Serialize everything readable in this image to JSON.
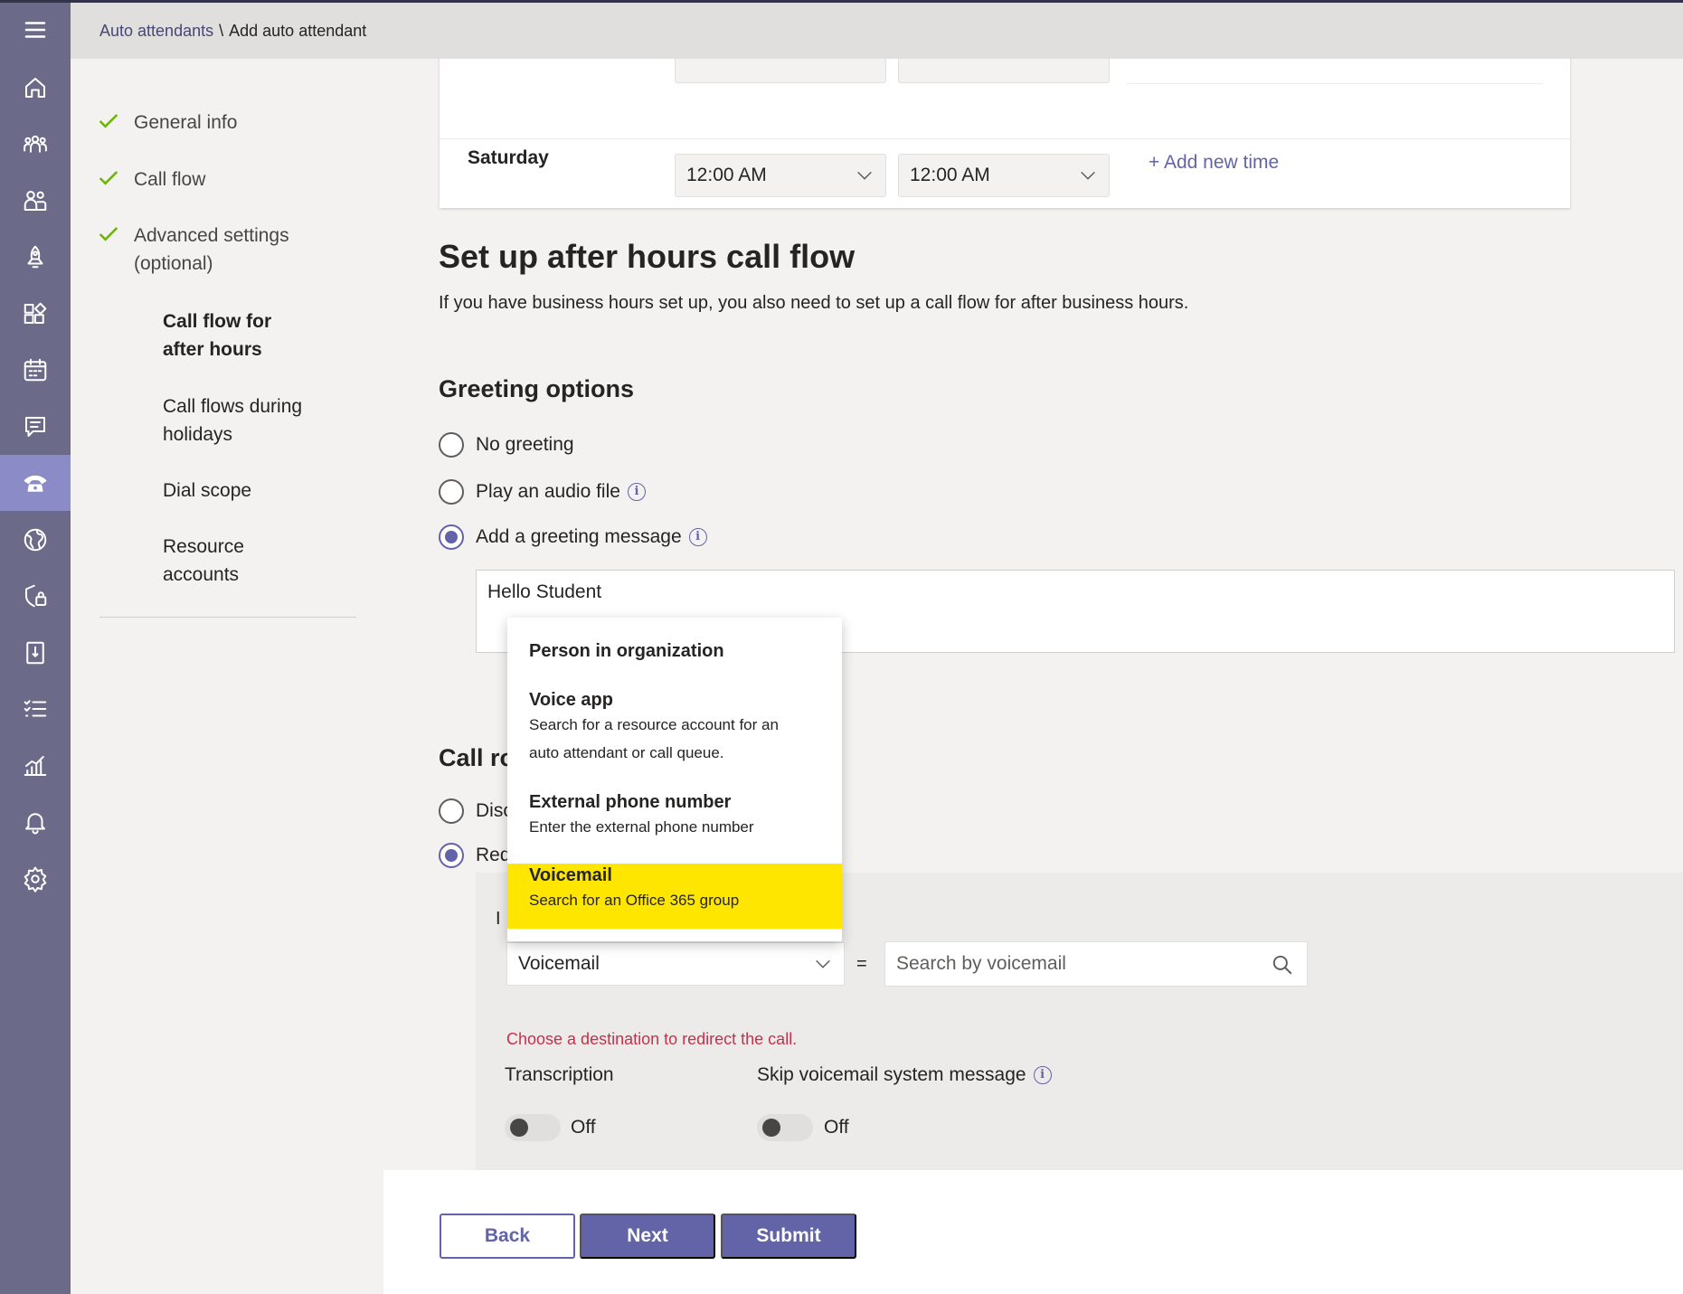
{
  "breadcrumb": {
    "parent": "Auto attendants",
    "separator": "\\",
    "current": "Add auto attendant"
  },
  "rail": {
    "icons": [
      "hamburger-menu-icon",
      "home-icon",
      "teams-icon",
      "users-icon",
      "meetings-icon",
      "apps-icon",
      "calendar-icon",
      "messaging-icon",
      "voice-icon",
      "globe-icon",
      "security-icon",
      "planning-icon",
      "checklist-icon",
      "analytics-icon",
      "notifications-icon",
      "settings-icon"
    ],
    "active": "voice-icon"
  },
  "steps": [
    {
      "label": "General info",
      "done": true
    },
    {
      "label": "Call flow",
      "done": true
    },
    {
      "label": "Advanced settings",
      "label2": "(optional)",
      "done": true
    },
    {
      "label": "Call flow for",
      "label2": "after hours",
      "current": true
    },
    {
      "label": "Call flows during",
      "label2": "holidays"
    },
    {
      "label": "Dial scope"
    },
    {
      "label": "Resource",
      "label2": "accounts"
    }
  ],
  "hours": {
    "day": "Saturday",
    "start": "12:00 AM",
    "end": "12:00 AM",
    "add_time": "+ Add new time"
  },
  "after_hours": {
    "title": "Set up after hours call flow",
    "intro": "If you have business hours set up, you also need to set up a call flow for after business hours."
  },
  "greeting": {
    "title": "Greeting options",
    "options": [
      "No greeting",
      "Play an audio file",
      "Add a greeting message"
    ],
    "selected": "Add a greeting message",
    "message": "Hello Student"
  },
  "routing": {
    "title": "Call ro",
    "options": [
      "Disc",
      "Red"
    ],
    "selected": "Red",
    "redirect_label": "I",
    "destination_value": "Voicemail",
    "equals": "=",
    "search_placeholder": "Search by voicemail",
    "error": "Choose a destination to redirect the call.",
    "transcription_label": "Transcription",
    "transcription_state": "Off",
    "skip_label": "Skip voicemail system message",
    "skip_state": "Off"
  },
  "dropdown": {
    "items": [
      {
        "title": "Person in organization",
        "desc": ""
      },
      {
        "title": "Voice app",
        "desc": "Search for a resource account for an",
        "desc2": "auto attendant or call queue."
      },
      {
        "title": "External phone number",
        "desc": "Enter the external phone number"
      },
      {
        "title": "Voicemail",
        "desc": "Search for an Office 365 group",
        "highlighted": true
      }
    ],
    "highlight_color": "#ffe600"
  },
  "footer": {
    "back": "Back",
    "next": "Next",
    "submit": "Submit"
  },
  "colors": {
    "accent": "#6264a7",
    "rail": "#6b6a88",
    "success": "#6bb700",
    "error": "#c4314b"
  }
}
